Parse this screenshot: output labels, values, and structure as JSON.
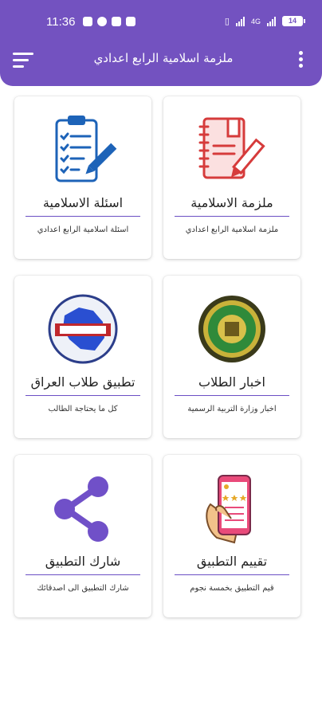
{
  "status_bar": {
    "time": "11:36",
    "signal_text": "4G",
    "battery": "14"
  },
  "app_bar": {
    "title": "ملزمة اسلامية الرابع اعدادي",
    "menu_icon": "hamburger-menu-icon",
    "more_icon": "more-vert-icon",
    "color": "#7352c0"
  },
  "cards": [
    {
      "label": "ملزمة الاسلامية",
      "sub": "ملزمة اسلامية الرابع اعدادي",
      "icon": "notebook-pen-icon"
    },
    {
      "label": "اسئلة الاسلامية",
      "sub": "اسئلة اسلامية الرابع اعدادي",
      "icon": "clipboard-checklist-icon"
    },
    {
      "label": "اخبار الطلاب",
      "sub": "اخبار وزارة التربية الرسمية",
      "icon": "ministry-seal-icon"
    },
    {
      "label": "تطبيق طلاب العراق",
      "sub": "كل ما يحتاجة الطالب",
      "icon": "iraq-map-logo-icon"
    },
    {
      "label": "تقييم التطبيق",
      "sub": "قيم التطبيق بخمسة نجوم",
      "icon": "phone-rating-icon"
    },
    {
      "label": "شارك التطبيق",
      "sub": "شارك التطبيق الى اصدقائك",
      "icon": "share-icon"
    }
  ]
}
